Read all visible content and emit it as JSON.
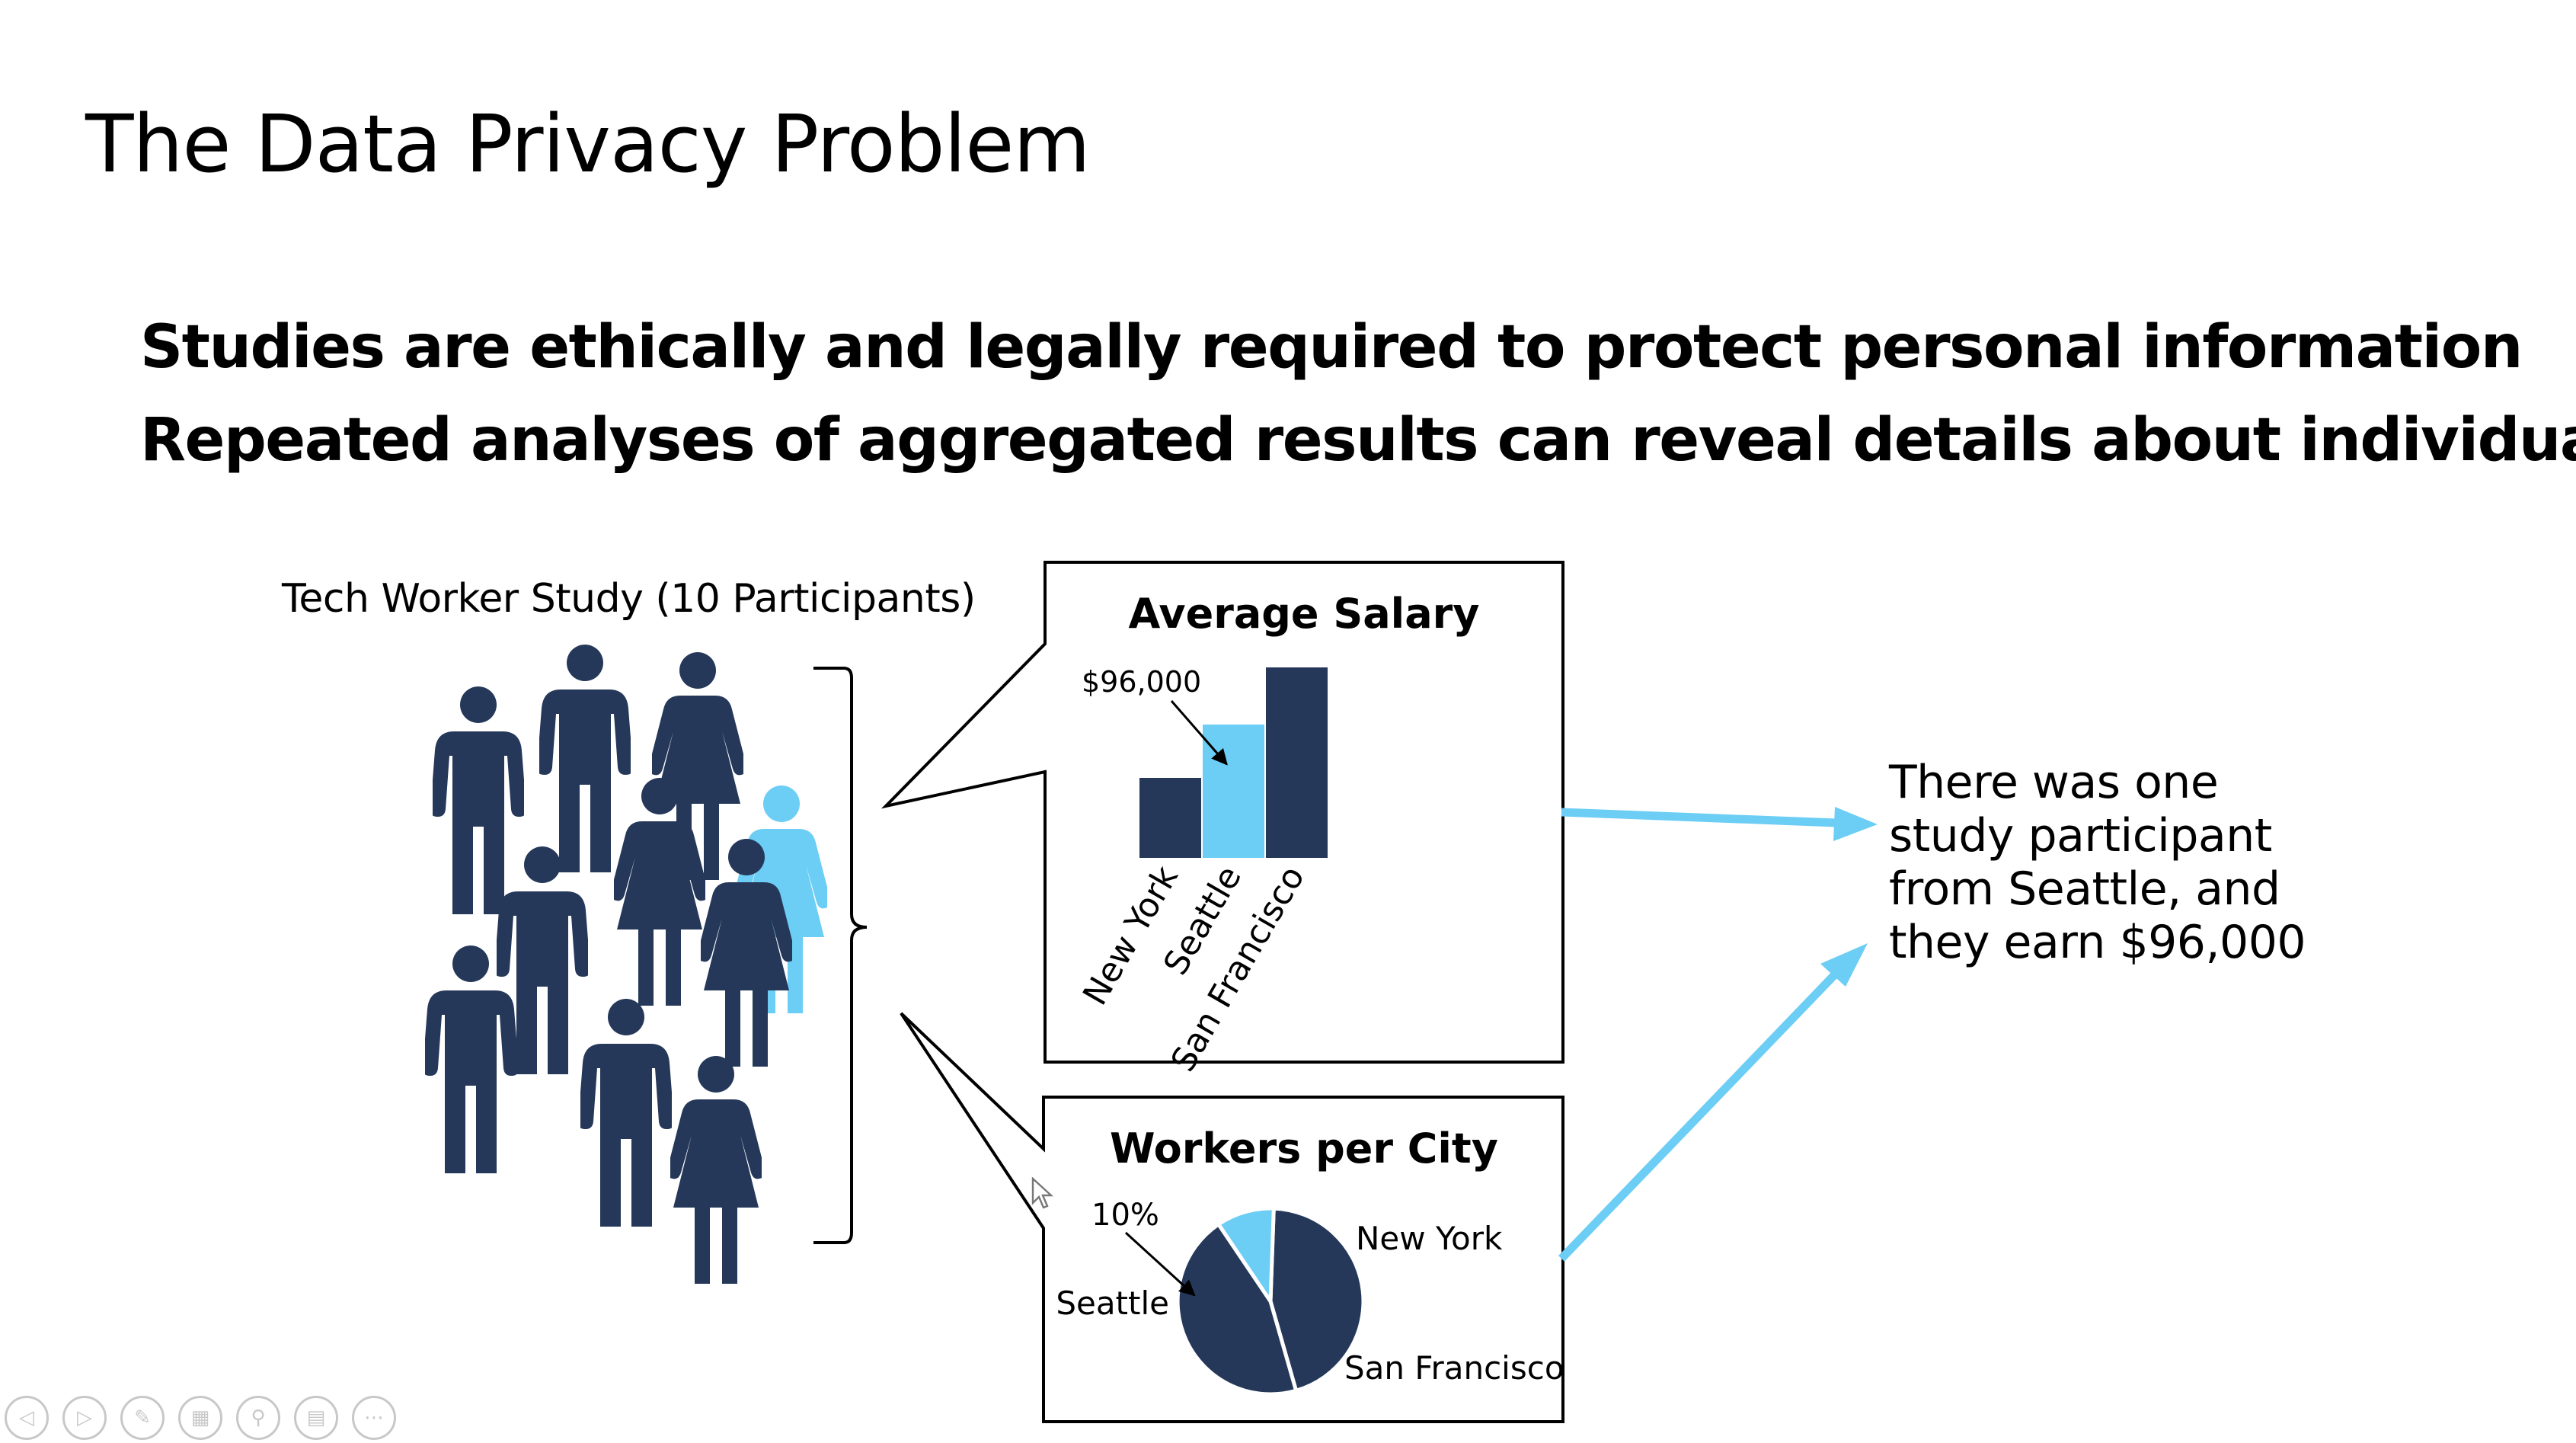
{
  "slide": {
    "title": "The Data Privacy Problem",
    "bullets": [
      "Studies are ethically and legally required to protect personal information",
      "Repeated analyses of aggregated results can reveal details about individuals"
    ],
    "study_label": "Tech Worker Study (10 Participants)",
    "participants": {
      "total": 10,
      "highlighted_index": 3,
      "figures": [
        "man",
        "man",
        "woman",
        "woman",
        "man",
        "woman",
        "man",
        "man",
        "woman",
        "woman"
      ]
    },
    "callout_lines": [
      "There was one",
      "study participant",
      "from Seattle, and",
      "they earn $96,000"
    ]
  },
  "colors": {
    "dark": "#253859",
    "highlight": "#6ccdf5",
    "arrow": "#6ccdf5",
    "text": "#000000",
    "toolbar": "#c8c8c8"
  },
  "chart_data": [
    {
      "type": "bar",
      "title": "Average Salary",
      "categories": [
        "New York",
        "Seattle",
        "San Francisco"
      ],
      "values": [
        42,
        70,
        100
      ],
      "highlight": "Seattle",
      "annotation": {
        "text": "$96,000",
        "target": "Seattle"
      },
      "xlabel": "",
      "ylabel": "",
      "ylim": [
        0,
        100
      ],
      "grid": false
    },
    {
      "type": "pie",
      "title": "Workers per City",
      "labels": [
        "New York",
        "San Francisco",
        "Seattle"
      ],
      "values": [
        45,
        45,
        10
      ],
      "highlight": "Seattle",
      "annotation": {
        "text": "10%",
        "target": "Seattle"
      }
    }
  ],
  "toolbar": {
    "buttons": [
      {
        "icon": "previous-icon",
        "glyph": "◁"
      },
      {
        "icon": "next-icon",
        "glyph": "▷"
      },
      {
        "icon": "pen-icon",
        "glyph": "✎"
      },
      {
        "icon": "slides-icon",
        "glyph": "▦"
      },
      {
        "icon": "zoom-icon",
        "glyph": "⚲"
      },
      {
        "icon": "subtitles-icon",
        "glyph": "▤"
      },
      {
        "icon": "more-icon",
        "glyph": "⋯"
      }
    ]
  }
}
